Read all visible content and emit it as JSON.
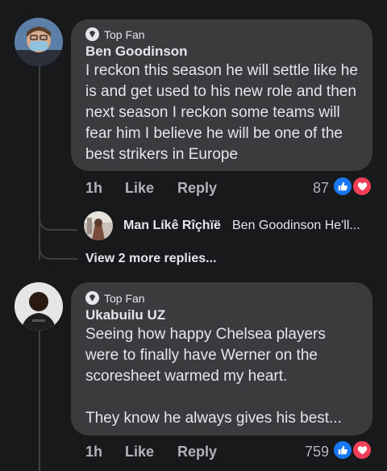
{
  "comments": [
    {
      "badge": "Top Fan",
      "author": "Ben Goodinson",
      "text": "I reckon this season he will settle like he is and get used to his new role and then next season I reckon some teams will fear him I believe he will be one of the best strikers in Europe",
      "time": "1h",
      "like_label": "Like",
      "reply_label": "Reply",
      "reaction_count": "87"
    },
    {
      "badge": "Top Fan",
      "author": "Ukabuilu UZ",
      "text": "Seeing how happy Chelsea players were to finally have Werner on the scoresheet warmed my heart.\n\nThey know he always gives his best...",
      "time": "1h",
      "like_label": "Like",
      "reply_label": "Reply",
      "reaction_count": "759"
    }
  ],
  "reply_preview": {
    "author": "Man Líkê Rîçhïë",
    "snippet": "Ben Goodinson He'll..."
  },
  "view_more_replies": "View 2 more replies...",
  "colors": {
    "background": "#18191a",
    "bubble": "#3a3b3c",
    "like_blue": "#1877f2",
    "love_red": "#f33e58",
    "secondary_text": "#b0b3b8"
  }
}
